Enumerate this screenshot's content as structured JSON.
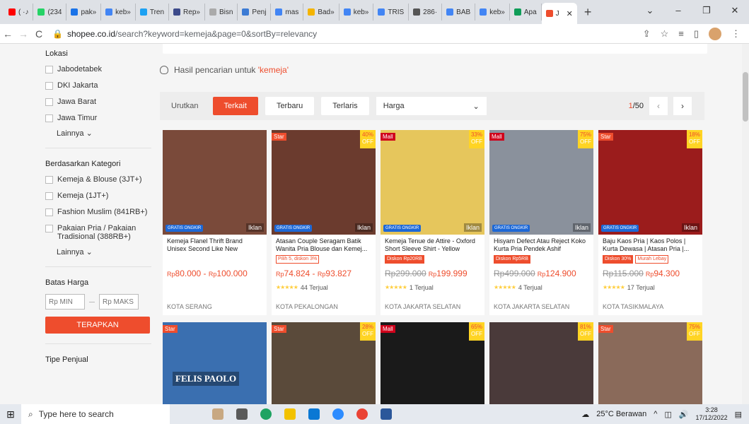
{
  "browser": {
    "tabs": [
      {
        "label": "( ·♪",
        "color": "#ff0000"
      },
      {
        "label": "(234",
        "color": "#25d366"
      },
      {
        "label": "pak»",
        "color": "#1a73e8"
      },
      {
        "label": "keb»",
        "color": "#4285f4"
      },
      {
        "label": "Tren",
        "color": "#1da1f2"
      },
      {
        "label": "Rep»",
        "color": "#3c4a8a"
      },
      {
        "label": "Bisn",
        "color": "#aaaaaa"
      },
      {
        "label": "Penj",
        "color": "#3c7bd4"
      },
      {
        "label": "mas",
        "color": "#4285f4"
      },
      {
        "label": "Bad»",
        "color": "#f4b400"
      },
      {
        "label": "keb»",
        "color": "#4285f4"
      },
      {
        "label": "TRIS",
        "color": "#4285f4"
      },
      {
        "label": "286·",
        "color": "#555555"
      },
      {
        "label": "BAB",
        "color": "#4285f4"
      },
      {
        "label": "keb»",
        "color": "#4285f4"
      },
      {
        "label": "Apa",
        "color": "#0f9d58"
      }
    ],
    "active_tab": {
      "label": "J",
      "color": "#ee4d2d"
    },
    "url_host": "shopee.co.id",
    "url_path": "/search?keyword=kemeja&page=0&sortBy=relevancy"
  },
  "sidebar": {
    "location_title": "Lokasi",
    "locations": [
      "Jabodetabek",
      "DKI Jakarta",
      "Jawa Barat",
      "Jawa Timur"
    ],
    "more_label": "Lainnya",
    "category_title": "Berdasarkan Kategori",
    "categories": [
      "Kemeja & Blouse (3JT+)",
      "Kemeja (1JT+)",
      "Fashion Muslim (841RB+)",
      "Pakaian Pria / Pakaian Tradisional (388RB+)"
    ],
    "price_title": "Batas Harga",
    "min_placeholder": "Rp MIN",
    "max_placeholder": "Rp MAKS",
    "apply_label": "TERAPKAN",
    "seller_title": "Tipe Penjual"
  },
  "result_hint": {
    "prefix": "Hasil pencarian untuk",
    "keyword": "'kemeja'"
  },
  "sort": {
    "label": "Urutkan",
    "options": [
      "Terkait",
      "Terbaru",
      "Terlaris"
    ],
    "price_label": "Harga",
    "page_current": "1",
    "page_total": "/50"
  },
  "products": [
    {
      "title": "Kemeja Flanel Thrift Brand Unisex Second Like New",
      "badge": "",
      "discount": "",
      "iklan": "Iklan",
      "price": "80.000 - ",
      "price2": "100.000",
      "old_price": "",
      "sold": "",
      "location": "KOTA SERANG",
      "tags": [],
      "img_color": "#7a4a3a"
    },
    {
      "title": "Atasan Couple Seragam Batik Wanita Pria Blouse dan Kemej...",
      "badge": "Star",
      "discount": "40%",
      "iklan": "Iklan",
      "price": "74.824 - ",
      "price2": "93.827",
      "old_price": "",
      "sold": "44 Terjual",
      "location": "KOTA PEKALONGAN",
      "tags": [
        "Pilih 5, diskon 3%"
      ],
      "img_color": "#6b3b2e"
    },
    {
      "title": "Kemeja Tenue de Attire - Oxford Short Sleeve Shirt - Yellow",
      "badge": "Mall",
      "discount": "33%",
      "iklan": "Iklan",
      "price": "199.999",
      "price2": "",
      "old_price": "Rp299.000",
      "sold": "1 Terjual",
      "location": "KOTA JAKARTA SELATAN",
      "tags": [
        "Diskon Rp20RB"
      ],
      "img_color": "#e6c65c"
    },
    {
      "title": "Hisyam Defect Atau Reject Koko Kurta Pria Pendek Ashif",
      "badge": "Mall",
      "discount": "75%",
      "iklan": "Iklan",
      "price": "124.900",
      "price2": "",
      "old_price": "Rp499.000",
      "sold": "4 Terjual",
      "location": "KOTA JAKARTA SELATAN",
      "tags": [
        "Diskon Rp5RB"
      ],
      "img_color": "#8a919c"
    },
    {
      "title": "Baju Kaos Pria | Kaos Polos | Kurta Dewasa | Atasan Pria |...",
      "badge": "Star",
      "discount": "18%",
      "iklan": "Iklan",
      "price": "94.300",
      "price2": "",
      "old_price": "Rp115.000",
      "sold": "17 Terjual",
      "location": "KOTA TASIKMALAYA",
      "tags": [
        "Diskon 30%",
        "Murah Lebay"
      ],
      "img_color": "#9b1c1c"
    }
  ],
  "row2": [
    {
      "badge": "Star",
      "discount": "",
      "img_color": "#3a6fb0",
      "text": "FELIS PAOLO"
    },
    {
      "badge": "Star",
      "discount": "28%",
      "img_color": "#5a4a3a",
      "text": ""
    },
    {
      "badge": "Mall",
      "discount": "65%",
      "img_color": "#1a1a1a",
      "text": ""
    },
    {
      "badge": "",
      "discount": "81%",
      "img_color": "#4a3a3a",
      "text": ""
    },
    {
      "badge": "Star",
      "discount": "75%",
      "img_color": "#8a6a5a",
      "text": ""
    }
  ],
  "labels": {
    "off": "OFF",
    "currency": "Rp",
    "ongkir": "GRATIS ONGKIR",
    "stars": "★★★★★"
  },
  "taskbar": {
    "search_placeholder": "Type here to search",
    "weather": "25°C Berawan",
    "time": "3:28",
    "date": "17/12/2022"
  }
}
